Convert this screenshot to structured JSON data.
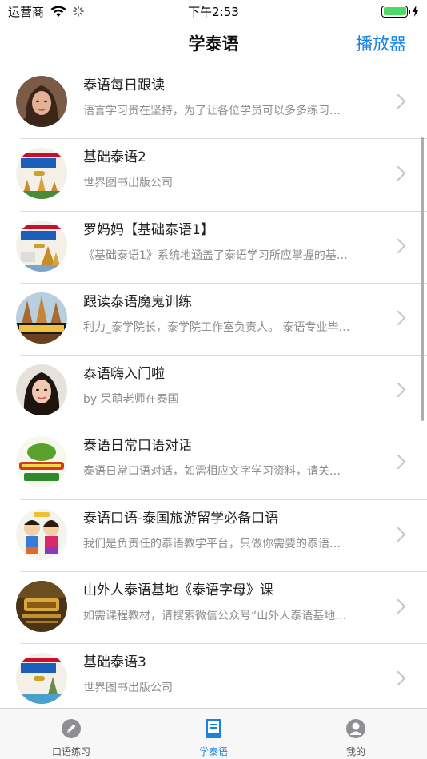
{
  "status": {
    "carrier": "运营商",
    "time": "下午2:53"
  },
  "nav": {
    "title": "学泰语",
    "right_button": "播放器"
  },
  "list": [
    {
      "title": "泰语每日跟读",
      "subtitle": "语言学习贵在坚持，为了让各位学员可以多多练习…",
      "icon": "woman-portrait-avatar"
    },
    {
      "title": "基础泰语2",
      "subtitle": "世界图书出版公司",
      "icon": "book-cover-avatar"
    },
    {
      "title": "罗妈妈【基础泰语1】",
      "subtitle": "《基础泰语1》系统地涵盖了泰语学习所应掌握的基…",
      "icon": "book-cover-avatar"
    },
    {
      "title": "跟读泰语魔鬼训练",
      "subtitle": "利力_泰学院长，泰学院工作室负责人。 泰语专业毕…",
      "icon": "temple-avatar"
    },
    {
      "title": "泰语嗨入门啦",
      "subtitle": "by 呆萌老师在泰国",
      "icon": "woman-portrait-avatar"
    },
    {
      "title": "泰语日常口语对话",
      "subtitle": "泰语日常口语对话，如需相应文字学习资料，请关…",
      "icon": "green-logo-avatar"
    },
    {
      "title": "泰语口语-泰国旅游留学必备口语",
      "subtitle": "我们是负责任的泰语教学平台，只做你需要的泰语…",
      "icon": "cartoon-kids-avatar"
    },
    {
      "title": "山外人泰语基地《泰语字母》课",
      "subtitle": "如需课程教材，请搜索微信公众号“山外人泰语基地…",
      "icon": "gold-logo-avatar"
    },
    {
      "title": "基础泰语3",
      "subtitle": "世界图书出版公司",
      "icon": "book-cover-avatar"
    }
  ],
  "tabs": [
    {
      "label": "口语练习",
      "icon": "pencil-icon",
      "active": false
    },
    {
      "label": "学泰语",
      "icon": "book-icon",
      "active": true
    },
    {
      "label": "我的",
      "icon": "user-icon",
      "active": false
    }
  ],
  "colors": {
    "accent": "#1a82e2",
    "battery": "#4cd964"
  }
}
